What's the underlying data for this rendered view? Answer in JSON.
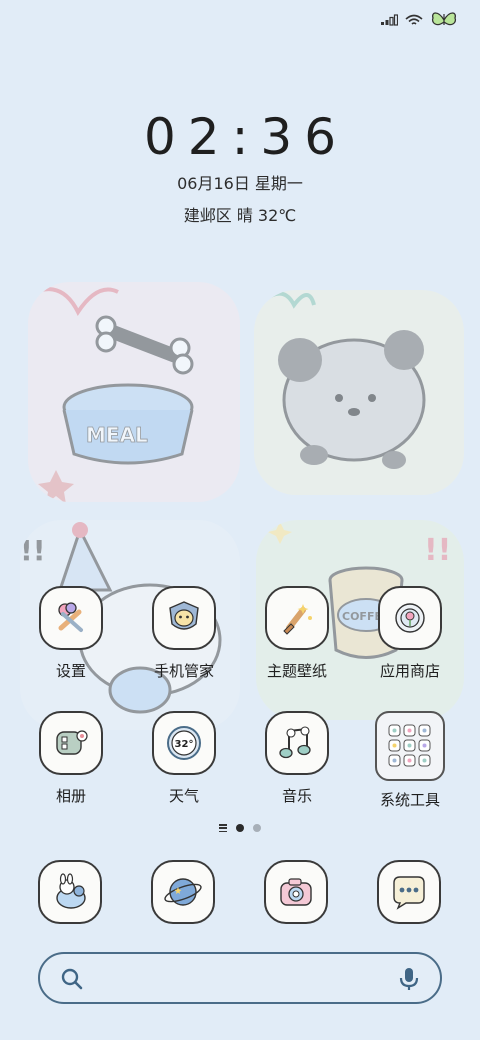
{
  "clock": {
    "time": "02:36",
    "date": "06月16日 星期一",
    "weather": "建邺区 晴 32℃"
  },
  "status_bar": {
    "icons": [
      "signal-icon",
      "wifi-icon",
      "battery-butterfly-icon"
    ]
  },
  "wallpaper": {
    "meal_bowl_text": "MEAL",
    "coffee_can_text": "COFFEE"
  },
  "apps": [
    {
      "label": "设置",
      "icon": "settings-tools-icon"
    },
    {
      "label": "手机管家",
      "icon": "phone-manager-icon"
    },
    {
      "label": "主题壁纸",
      "icon": "theme-brush-icon"
    },
    {
      "label": "应用商店",
      "icon": "app-store-icon"
    },
    {
      "label": "相册",
      "icon": "gallery-icon"
    },
    {
      "label": "天气",
      "icon": "weather-icon",
      "badge": "32°"
    },
    {
      "label": "音乐",
      "icon": "music-icon"
    },
    {
      "label": "系统工具",
      "icon": "system-tools-folder-icon"
    }
  ],
  "page_indicator": {
    "pages": 2,
    "current": 1
  },
  "dock": [
    "phone-icon",
    "browser-planet-icon",
    "camera-icon",
    "messages-icon"
  ],
  "search_bar": {
    "icons": [
      "search-icon",
      "microphone-icon"
    ]
  },
  "colors": {
    "background": "#e1ecf7",
    "icon_border": "#3a3a3a",
    "search_border": "#4a6c88"
  }
}
